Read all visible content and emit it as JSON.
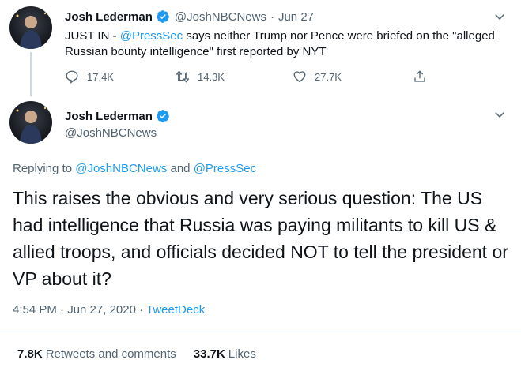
{
  "tweet1": {
    "name": "Josh Lederman",
    "handle": "@JoshNBCNews",
    "separator": "·",
    "date": "Jun 27",
    "text_prefix": "JUST IN - ",
    "mention": "@PressSec",
    "text_rest": " says neither Trump nor Pence were briefed on the \"alleged Russian bounty intelligence\" first reported by NYT",
    "replies": "17.4K",
    "retweets": "14.3K",
    "likes": "27.7K"
  },
  "tweet2": {
    "name": "Josh Lederman",
    "handle": "@JoshNBCNews",
    "replying_prefix": "Replying to ",
    "replying_user1": "@JoshNBCNews",
    "replying_and": " and ",
    "replying_user2": "@PressSec",
    "text": "This raises the obvious and very serious question: The US had intelligence that Russia was paying militants to kill US & allied troops, and officials decided NOT to tell the president or VP about it?",
    "time": "4:54 PM · Jun 27, 2020 · ",
    "source": "TweetDeck",
    "retweets_count": "7.8K",
    "retweets_label": "Retweets and comments",
    "likes_count": "33.7K",
    "likes_label": "Likes"
  },
  "icons": {
    "verified": "verified-badge-icon",
    "reply": "reply-icon",
    "retweet": "retweet-icon",
    "like": "heart-icon",
    "share": "share-icon",
    "more": "chevron-down-icon"
  },
  "colors": {
    "accent": "#1d9bf0",
    "secondary": "#536471",
    "text": "#0f1419"
  }
}
